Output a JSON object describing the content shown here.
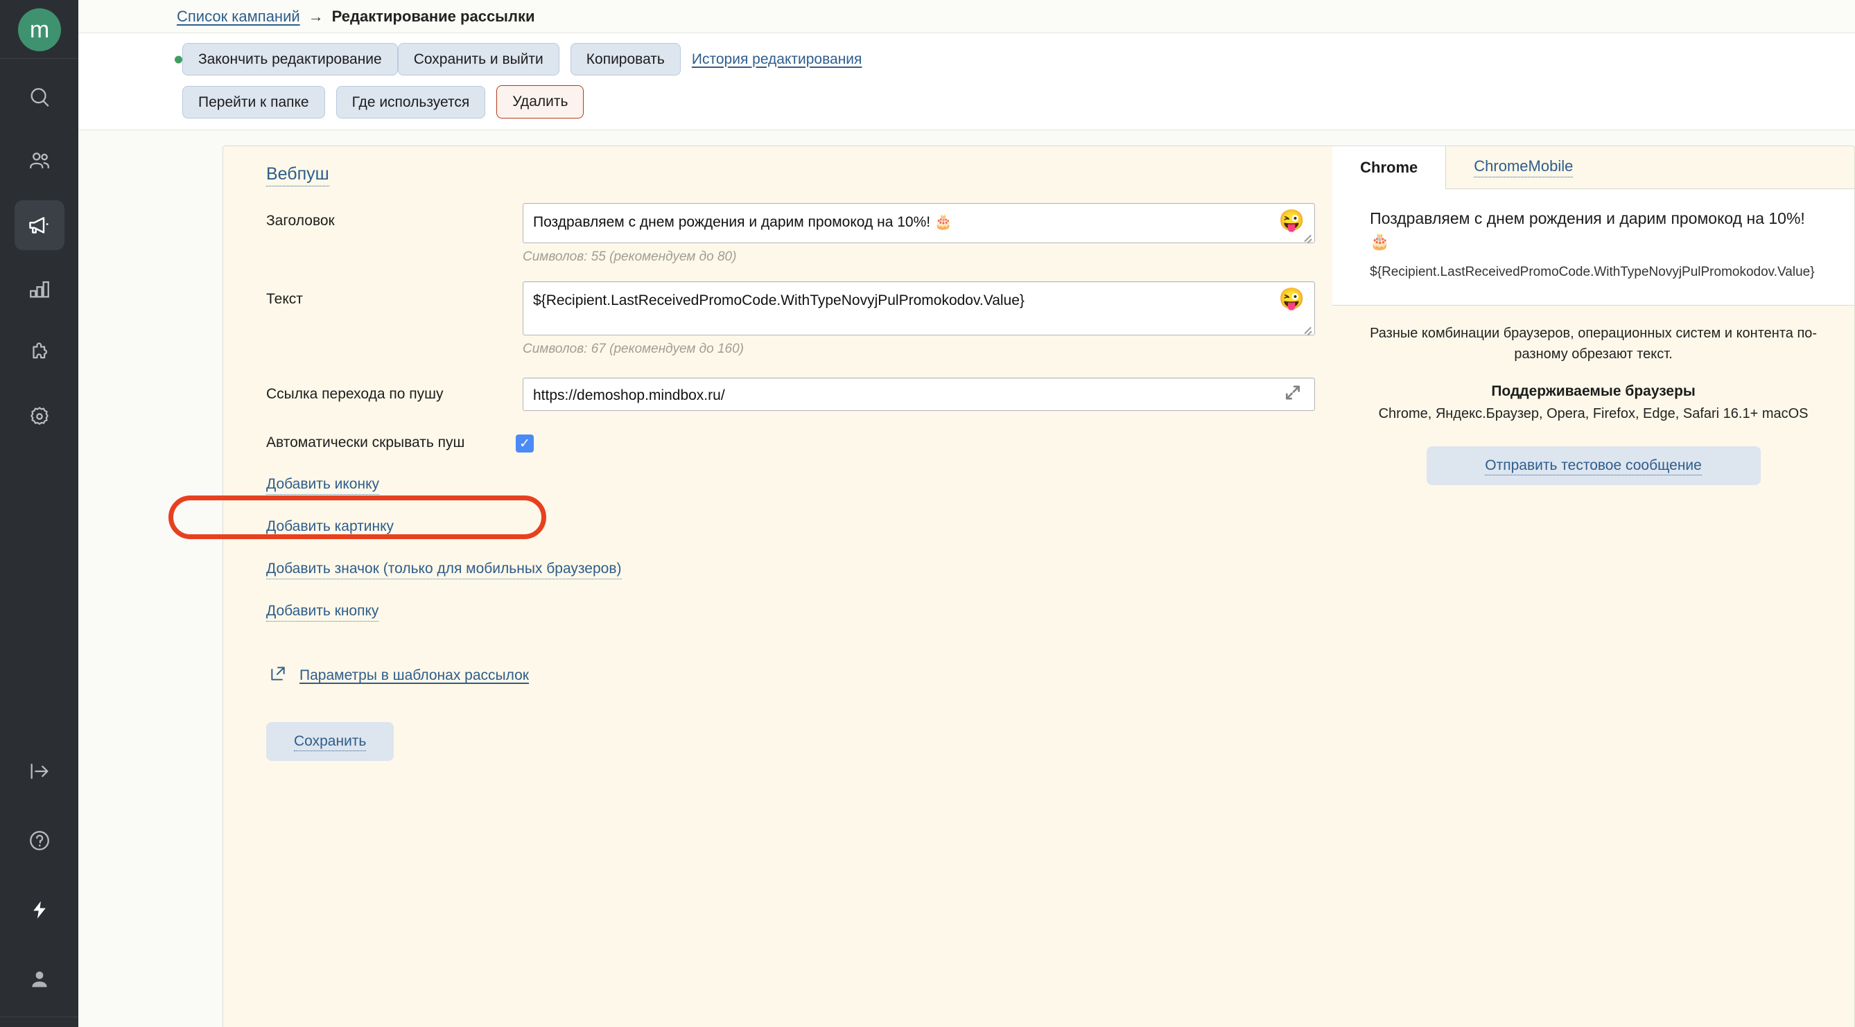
{
  "brand": {
    "logo_letter": "m",
    "logo_color": "#3f9270"
  },
  "sidebar": {
    "items": [
      {
        "name": "search-icon",
        "label": "Поиск"
      },
      {
        "name": "customers-icon",
        "label": "Клиенты"
      },
      {
        "name": "campaigns-icon",
        "label": "Кампании"
      },
      {
        "name": "analytics-icon",
        "label": "Аналитика"
      },
      {
        "name": "integrations-icon",
        "label": "Интеграции"
      },
      {
        "name": "settings-icon",
        "label": "Настройки"
      }
    ],
    "bottom_items": [
      {
        "name": "expand-sidebar-icon",
        "label": "Развернуть"
      },
      {
        "name": "help-icon",
        "label": "Помощь"
      },
      {
        "name": "quick-actions-icon",
        "label": "Быстрые действия"
      },
      {
        "name": "account-icon",
        "label": "Аккаунт"
      }
    ]
  },
  "breadcrumb": {
    "parent": "Список кампаний",
    "arrow": "→",
    "current": "Редактирование рассылки"
  },
  "toolbar": {
    "finish_editing": "Закончить редактирование",
    "save_and_exit": "Сохранить и выйти",
    "copy": "Копировать",
    "history_link": "История редактирования",
    "go_to_folder": "Перейти к папке",
    "where_used": "Где используется",
    "delete": "Удалить"
  },
  "form": {
    "section_title": "Вебпуш",
    "title_label": "Заголовок",
    "title_value": "Поздравляем с днем рождения и дарим промокод на 10%! 🎂",
    "title_hint": "Символов: 55 (рекомендуем до 80)",
    "text_label": "Текст",
    "text_value": "${Recipient.LastReceivedPromoCode.WithTypeNovyjPulPromokodov.Value}",
    "text_hint": "Символов: 67 (рекомендуем до 160)",
    "url_label": "Ссылка перехода по пушу",
    "url_value": "https://demoshop.mindbox.ru/",
    "autohide_label": "Автоматически скрывать пуш",
    "autohide_checked": true,
    "emoji_button": "😜",
    "links": [
      "Добавить иконку",
      "Добавить картинку",
      "Добавить значок (только для мобильных браузеров)",
      "Добавить кнопку"
    ],
    "params_link": "Параметры в шаблонах рассылок",
    "save_label": "Сохранить"
  },
  "preview": {
    "tabs": [
      {
        "label": "Chrome",
        "active": true
      },
      {
        "label": "ChromeMobile",
        "active": false
      }
    ],
    "notification_title": "Поздравляем с днем рождения и дарим промокод на 10%! 🎂",
    "notification_body": "${Recipient.LastReceivedPromoCode.WithTypeNovyjPulPromokodov.Value}",
    "note": "Разные комбинации браузеров, операционных систем и контента по-разному обрезают текст.",
    "supported_heading": "Поддерживаемые браузеры",
    "supported_list": "Chrome, Яндекс.Браузер, Opera, Firefox, Edge, Safari 16.1+ macOS",
    "send_test_label": "Отправить тестовое сообщение"
  },
  "annotation": {
    "color": "#e8401f",
    "target": "url-row"
  }
}
